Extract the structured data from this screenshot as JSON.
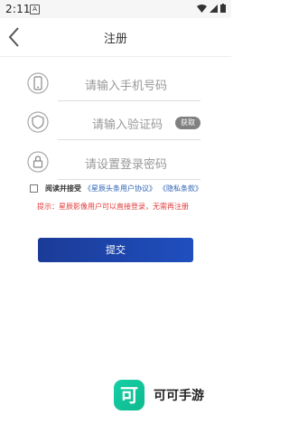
{
  "status_bar": {
    "time": "2:11",
    "app_icon_letter": "A"
  },
  "nav": {
    "back_icon": "chevron-left-icon",
    "title": "注册"
  },
  "form": {
    "phone": {
      "placeholder": "请输入手机号码",
      "icon": "phone-icon"
    },
    "code": {
      "placeholder": "请输入验证码",
      "icon": "shield-icon",
      "get_code_label": "获取"
    },
    "password": {
      "placeholder": "请设置登录密码",
      "icon": "lock-icon"
    },
    "agreement": {
      "lead": "阅读并接受",
      "link1": "《星辰头条用户协议》",
      "link2": "《隐私条款》"
    },
    "hint": "提示：星辰影像用户可以直接登录，无需再注册",
    "submit_label": "提交"
  },
  "brand": {
    "logo_char": "可",
    "name": "可可手游"
  },
  "colors": {
    "accent": "#1f4fbf",
    "hint": "#e33b3b",
    "link": "#2f63b5",
    "brand": "#15cfa6"
  }
}
